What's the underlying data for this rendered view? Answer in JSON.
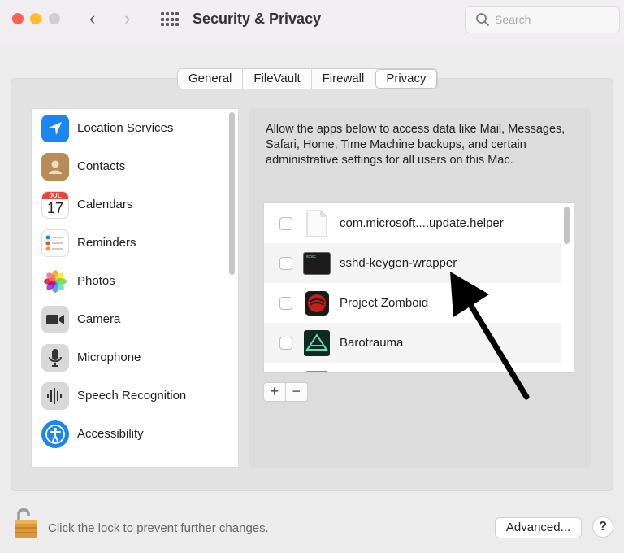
{
  "window": {
    "title": "Security & Privacy"
  },
  "search": {
    "placeholder": "Search"
  },
  "tabs": [
    {
      "label": "General"
    },
    {
      "label": "FileVault"
    },
    {
      "label": "Firewall"
    },
    {
      "label": "Privacy",
      "active": true
    }
  ],
  "sidebar": {
    "items": [
      {
        "label": "Location Services",
        "icon": "location-arrow-icon"
      },
      {
        "label": "Contacts",
        "icon": "contacts-icon"
      },
      {
        "label": "Calendars",
        "icon": "calendar-icon",
        "icon_month": "JUL",
        "icon_day": "17"
      },
      {
        "label": "Reminders",
        "icon": "reminders-icon"
      },
      {
        "label": "Photos",
        "icon": "photos-icon"
      },
      {
        "label": "Camera",
        "icon": "camera-icon"
      },
      {
        "label": "Microphone",
        "icon": "microphone-icon"
      },
      {
        "label": "Speech Recognition",
        "icon": "waveform-icon"
      },
      {
        "label": "Accessibility",
        "icon": "accessibility-icon"
      }
    ]
  },
  "content": {
    "description": "Allow the apps below to access data like Mail, Messages, Safari, Home, Time Machine backups, and certain administrative settings for all users on this Mac.",
    "apps": [
      {
        "name": "com.microsoft....update.helper",
        "checked": false,
        "icon": "document-icon"
      },
      {
        "name": "sshd-keygen-wrapper",
        "checked": false,
        "icon": "terminal-icon",
        "icon_text": "exec"
      },
      {
        "name": "Project Zomboid",
        "checked": false,
        "icon": "project-zomboid-icon"
      },
      {
        "name": "Barotrauma",
        "checked": false,
        "icon": "barotrauma-icon"
      }
    ],
    "add_label": "+",
    "remove_label": "−"
  },
  "footer": {
    "lock_text": "Click the lock to prevent further changes.",
    "advanced_label": "Advanced...",
    "help_label": "?"
  },
  "colors": {
    "accent_blue": "#1b86f0",
    "close": "#fe5f57",
    "minimize": "#febc2e"
  }
}
